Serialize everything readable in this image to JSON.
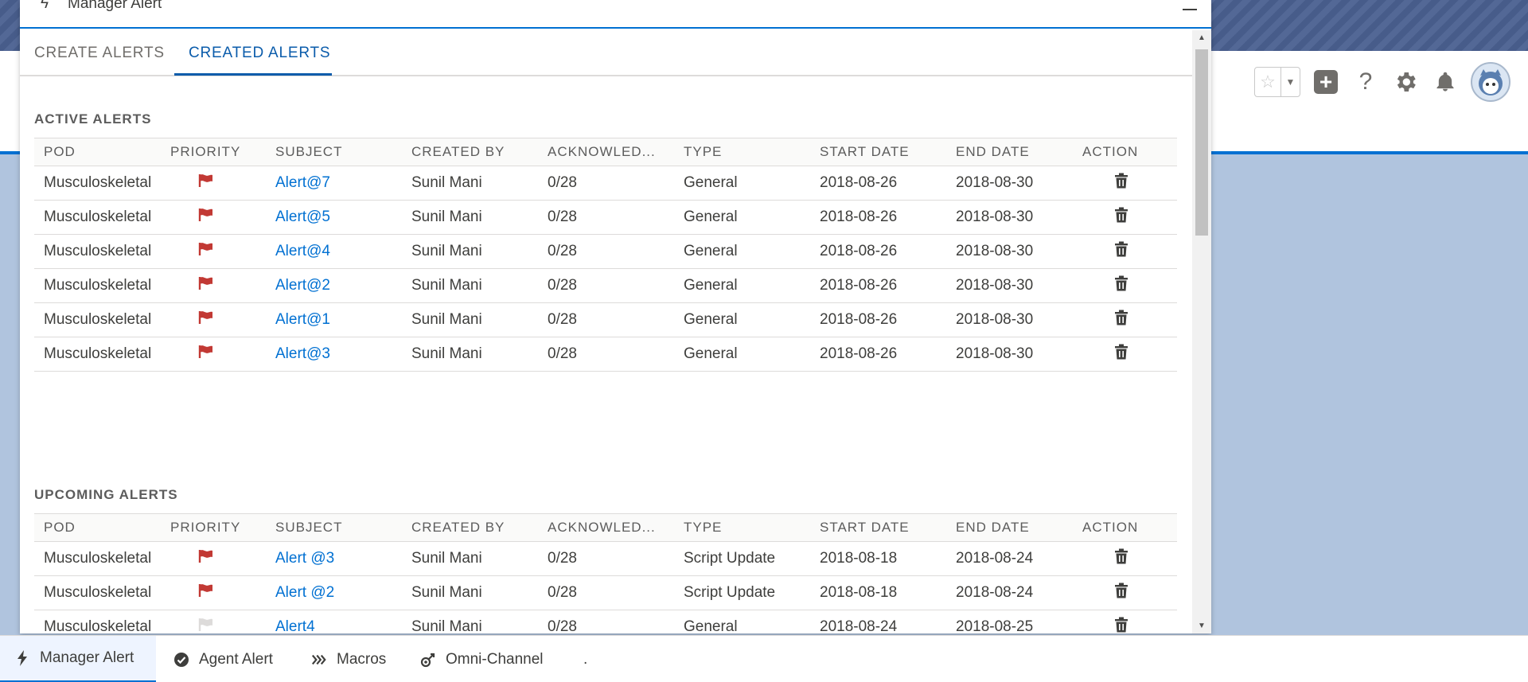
{
  "panel": {
    "title": "Manager Alert",
    "tabs": [
      {
        "label": "CREATE ALERTS",
        "active": false
      },
      {
        "label": "CREATED ALERTS",
        "active": true
      }
    ]
  },
  "columns": [
    "POD",
    "PRIORITY",
    "SUBJECT",
    "CREATED BY",
    "ACKNOWLED...",
    "TYPE",
    "START DATE",
    "END DATE",
    "ACTION"
  ],
  "active_alerts": {
    "title": "ACTIVE ALERTS",
    "rows": [
      {
        "pod": "Musculoskeletal",
        "priority": "high",
        "subject": "Alert@7",
        "created_by": "Sunil Mani",
        "ack": "0/28",
        "type": "General",
        "start": "2018-08-26",
        "end": "2018-08-30"
      },
      {
        "pod": "Musculoskeletal",
        "priority": "high",
        "subject": "Alert@5",
        "created_by": "Sunil Mani",
        "ack": "0/28",
        "type": "General",
        "start": "2018-08-26",
        "end": "2018-08-30"
      },
      {
        "pod": "Musculoskeletal",
        "priority": "high",
        "subject": "Alert@4",
        "created_by": "Sunil Mani",
        "ack": "0/28",
        "type": "General",
        "start": "2018-08-26",
        "end": "2018-08-30"
      },
      {
        "pod": "Musculoskeletal",
        "priority": "high",
        "subject": "Alert@2",
        "created_by": "Sunil Mani",
        "ack": "0/28",
        "type": "General",
        "start": "2018-08-26",
        "end": "2018-08-30"
      },
      {
        "pod": "Musculoskeletal",
        "priority": "high",
        "subject": "Alert@1",
        "created_by": "Sunil Mani",
        "ack": "0/28",
        "type": "General",
        "start": "2018-08-26",
        "end": "2018-08-30"
      },
      {
        "pod": "Musculoskeletal",
        "priority": "high",
        "subject": "Alert@3",
        "created_by": "Sunil Mani",
        "ack": "0/28",
        "type": "General",
        "start": "2018-08-26",
        "end": "2018-08-30"
      }
    ]
  },
  "upcoming_alerts": {
    "title": "UPCOMING ALERTS",
    "rows": [
      {
        "pod": "Musculoskeletal",
        "priority": "high",
        "subject": "Alert @3",
        "created_by": "Sunil Mani",
        "ack": "0/28",
        "type": "Script Update",
        "start": "2018-08-18",
        "end": "2018-08-24"
      },
      {
        "pod": "Musculoskeletal",
        "priority": "high",
        "subject": "Alert @2",
        "created_by": "Sunil Mani",
        "ack": "0/28",
        "type": "Script Update",
        "start": "2018-08-18",
        "end": "2018-08-24"
      },
      {
        "pod": "Musculoskeletal",
        "priority": "low",
        "subject": "Alert4",
        "created_by": "Sunil Mani",
        "ack": "0/28",
        "type": "General",
        "start": "2018-08-24",
        "end": "2018-08-25"
      }
    ]
  },
  "utility_bar": [
    {
      "label": "Manager Alert",
      "icon": "bolt-icon",
      "active": true
    },
    {
      "label": "Agent Alert",
      "icon": "check-circle-icon",
      "active": false
    },
    {
      "label": "Macros",
      "icon": "chevrons-icon",
      "active": false
    },
    {
      "label": "Omni-Channel",
      "icon": "omni-icon",
      "active": false
    },
    {
      "label": ".",
      "icon": "",
      "active": false
    }
  ],
  "colors": {
    "accent": "#0070d2",
    "flag_high": "#c23934",
    "flag_low": "#dddbda",
    "link": "#0070d2"
  }
}
